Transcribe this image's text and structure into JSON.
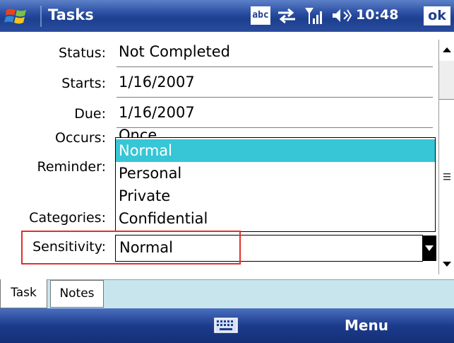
{
  "titlebar": {
    "app_title": "Tasks",
    "input_icon_text": "abc",
    "time": "10:48",
    "ok_label": "ok",
    "icons": [
      "windows-start-icon",
      "input-method-icon",
      "connectivity-icon",
      "signal-icon",
      "volume-icon"
    ]
  },
  "form": {
    "status": {
      "label": "Status:",
      "value": "Not Completed"
    },
    "starts": {
      "label": "Starts:",
      "value": "1/16/2007"
    },
    "due": {
      "label": "Due:",
      "value": "1/16/2007"
    },
    "occurs": {
      "label": "Occurs:",
      "value": "Once"
    },
    "reminder": {
      "label": "Reminder:"
    },
    "categories": {
      "label": "Categories:"
    },
    "sensitivity": {
      "label": "Sensitivity:",
      "value": "Normal"
    }
  },
  "dropdown": {
    "options": [
      "Normal",
      "Personal",
      "Private",
      "Confidential"
    ],
    "selected": "Normal"
  },
  "tabs": [
    "Task",
    "Notes"
  ],
  "menubar": {
    "menu_label": "Menu"
  },
  "colors": {
    "titlebar": "#2b4fa3",
    "selection": "#36c6d6",
    "highlight_box": "#e0302d",
    "tab_background": "#c8e5ee"
  }
}
